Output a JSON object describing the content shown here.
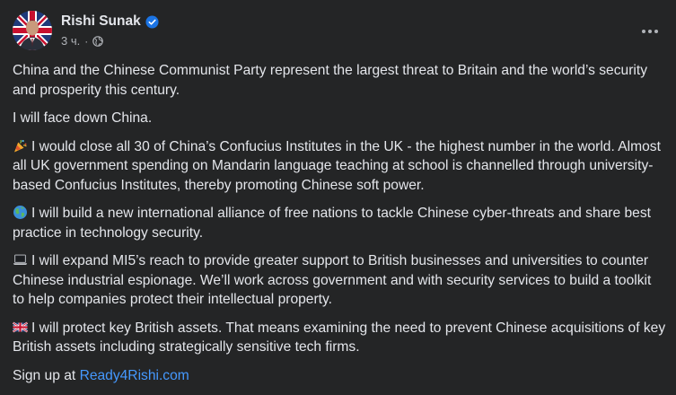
{
  "post": {
    "author": "Rishi Sunak",
    "timestamp": "3 ч.",
    "audience_icon": "globe-icon",
    "verified_icon": "verified-badge-icon",
    "more_icon": "more-options-icon",
    "paragraphs": {
      "p1": "China and the Chinese Communist Party represent the largest threat to Britain and the world’s security and prosperity this century.",
      "p2": "I will face down China.",
      "p3": "I would close all 30 of China’s Confucius Institutes in the UK - the highest number in the world. Almost all UK government spending on Mandarin language teaching at school is channelled through university-based Confucius Institutes, thereby promoting Chinese soft power.",
      "p4": "I will build a new international alliance of free nations to tackle Chinese cyber-threats and share best practice in technology security.",
      "p5": "I will expand MI5’s reach to provide greater support to British businesses and universities to counter Chinese industrial espionage. We’ll work across government and with security services to build a toolkit to help companies protect their intellectual property.",
      "p6": "I will protect key British assets. That means examining the need to prevent Chinese acquisitions of key British assets including strategically sensitive tech firms.",
      "signup_prefix": "Sign up at ",
      "signup_link": "Ready4Rishi.com"
    },
    "emoji_icons": {
      "p3": "party-popper-icon",
      "p4": "globe-earth-icon",
      "p5": "laptop-icon",
      "p6": "uk-flag-icon"
    },
    "colors": {
      "background": "#242526",
      "text": "#e4e6eb",
      "secondary": "#b0b3b8",
      "link": "#4599ff",
      "verified": "#1b74e4"
    }
  }
}
